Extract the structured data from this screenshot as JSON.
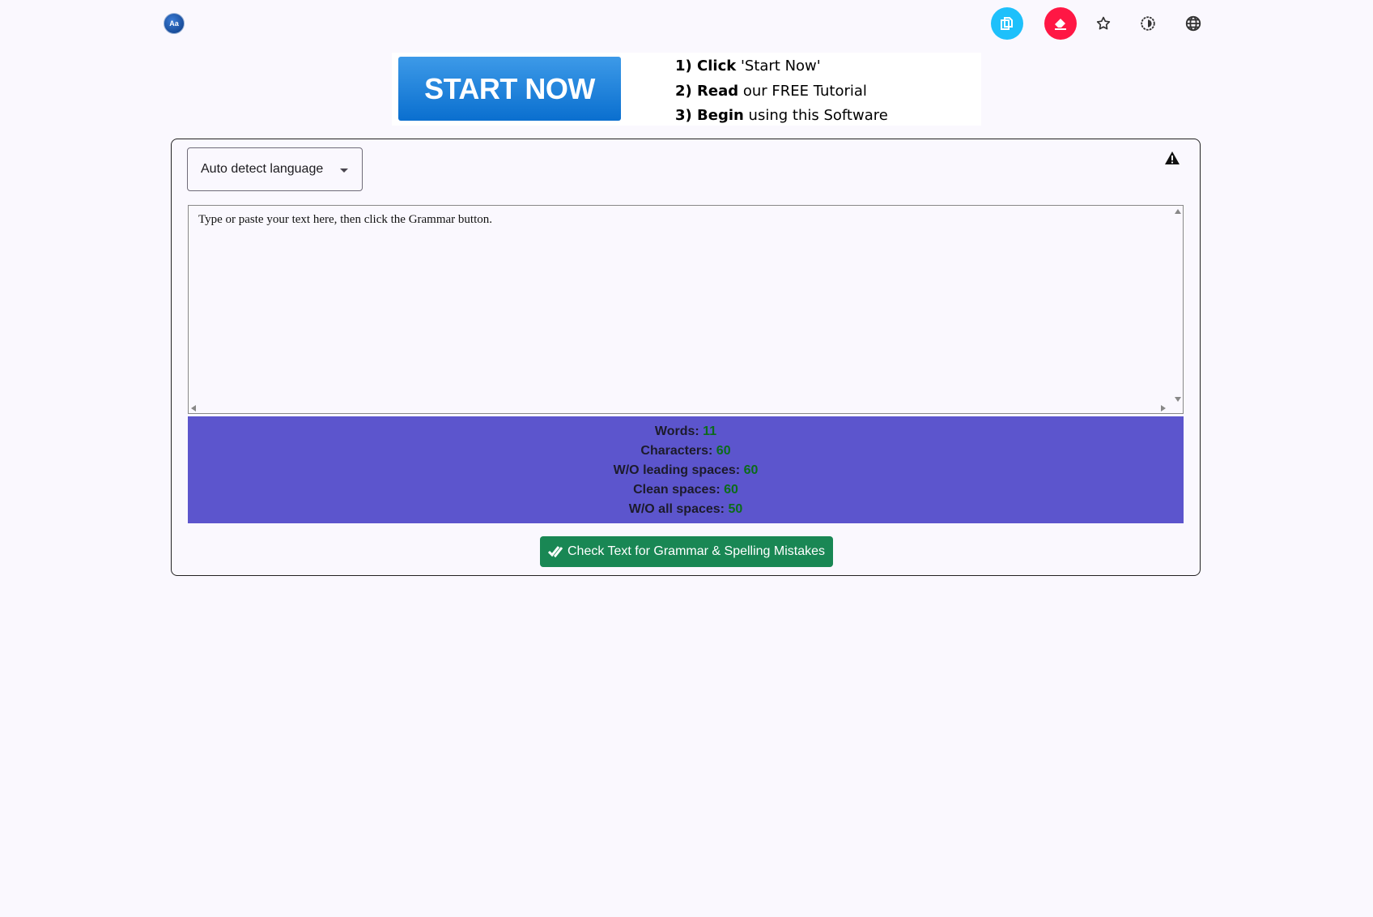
{
  "header": {
    "logo_text": "Aa",
    "icons": [
      {
        "name": "copy-icon",
        "color": "#1ec0fb"
      },
      {
        "name": "eraser-icon",
        "color": "#ff1744"
      },
      {
        "name": "star-icon"
      },
      {
        "name": "theme-icon"
      },
      {
        "name": "globe-icon"
      }
    ]
  },
  "banner": {
    "button": "START NOW",
    "steps": [
      {
        "bold": "1) Click",
        "rest": " 'Start Now'"
      },
      {
        "bold": "2) Read",
        "rest": " our FREE Tutorial"
      },
      {
        "bold": "3) Begin",
        "rest": "  using  this Software"
      }
    ]
  },
  "editor": {
    "language_select": "Auto detect language",
    "text": "Type or paste your text here, then click the Grammar button."
  },
  "stats": [
    {
      "label": "Words",
      "value": "11"
    },
    {
      "label": "Characters",
      "value": "60"
    },
    {
      "label": "W/O leading spaces",
      "value": "60"
    },
    {
      "label": "Clean spaces",
      "value": "60"
    },
    {
      "label": "W/O all spaces",
      "value": "50"
    }
  ],
  "check_button": "Check Text for Grammar & Spelling Mistakes",
  "colors": {
    "stats_bg": "#5c55cd",
    "value_green": "#0c6b1a",
    "button_green": "#198754"
  }
}
